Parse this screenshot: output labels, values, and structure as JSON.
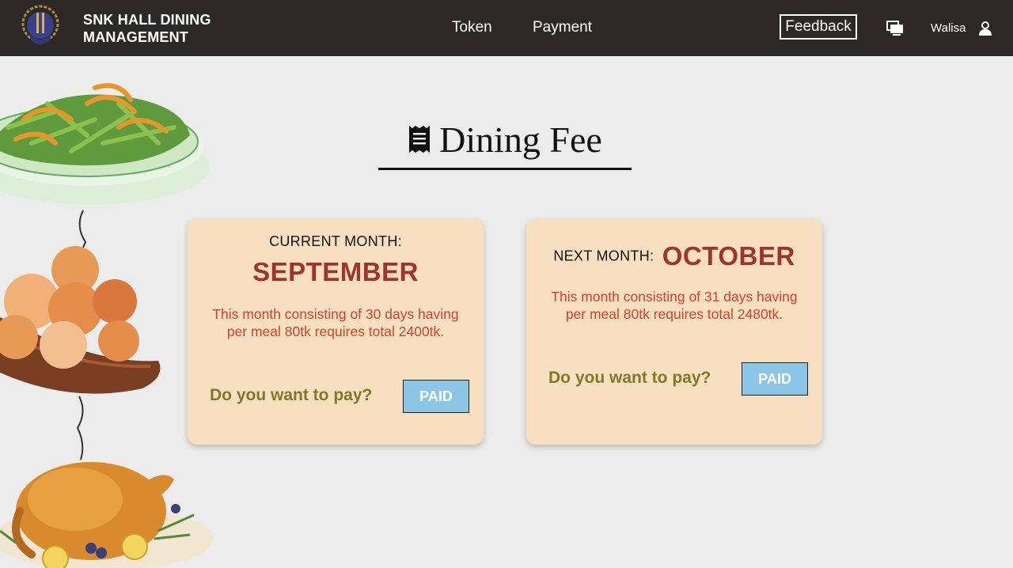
{
  "header": {
    "brand_line1": "SNK HALL DINING",
    "brand_line2": "MANAGEMENT",
    "nav": {
      "token": "Token",
      "payment": "Payment"
    },
    "feedback": "Feedback",
    "username": "Walisa",
    "icons": [
      "logo",
      "monitor-icon",
      "user-icon"
    ]
  },
  "page": {
    "title": "Dining Fee",
    "title_icon": "receipt-icon"
  },
  "cards": {
    "current": {
      "label": "CURRENT MONTH:",
      "month": "SEPTEMBER",
      "description": "This month consisting of 30 days having per meal 80tk requires total 2400tk.",
      "question": "Do you want to pay?",
      "button": "PAID"
    },
    "next": {
      "label": "NEXT MONTH:",
      "month": "OCTOBER",
      "description": "This month consisting of 31 days having per meal 80tk requires total 2480tk.",
      "question": "Do you want to pay?",
      "button": "PAID"
    }
  },
  "colors": {
    "header_bg": "#2b2826",
    "page_bg": "#ececec",
    "card_bg": "#f7dfc0",
    "month_text": "#a0342a",
    "description_text": "#d8402e",
    "question_text": "#7f7a28",
    "button_bg": "#8cc6e6"
  }
}
